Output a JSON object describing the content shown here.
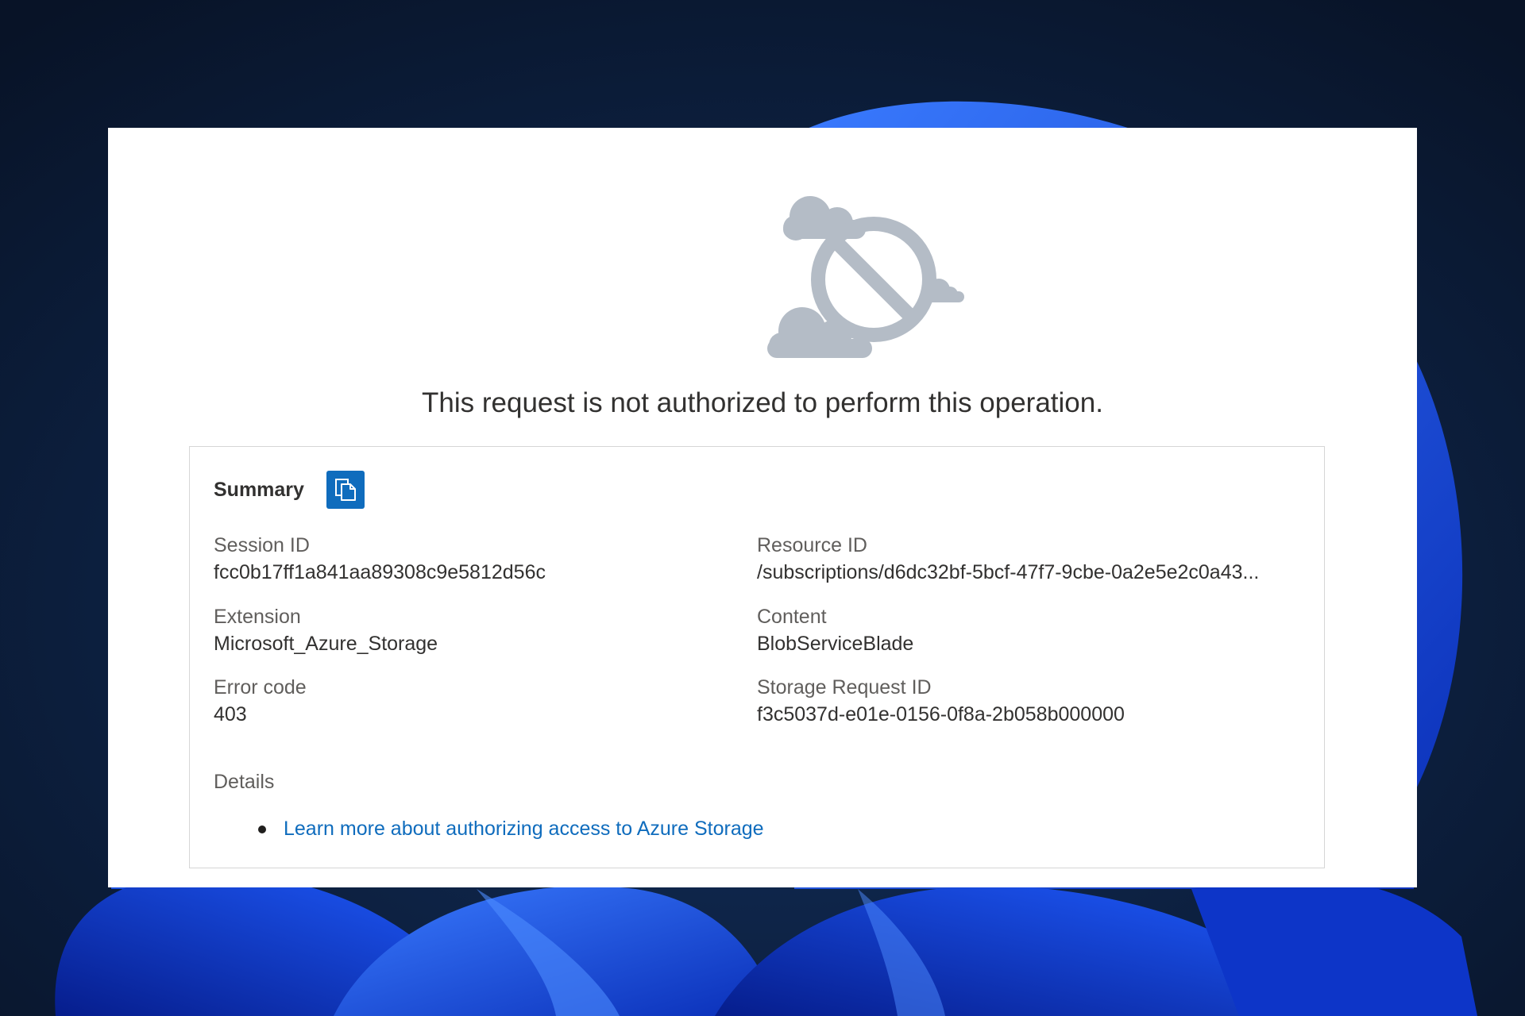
{
  "dialog": {
    "message": "This request is not authorized to perform this operation.",
    "summary": {
      "title": "Summary",
      "copy_icon": "copy-icon",
      "fields": {
        "session_id": {
          "label": "Session ID",
          "value": "fcc0b17ff1a841aa89308c9e5812d56c"
        },
        "resource_id": {
          "label": "Resource ID",
          "value": "/subscriptions/d6dc32bf-5bcf-47f7-9cbe-0a2e5e2c0a43..."
        },
        "extension": {
          "label": "Extension",
          "value": "Microsoft_Azure_Storage"
        },
        "content": {
          "label": "Content",
          "value": "BlobServiceBlade"
        },
        "error_code": {
          "label": "Error code",
          "value": "403"
        },
        "storage_request_id": {
          "label": "Storage Request ID",
          "value": "f3c5037d-e01e-0156-0f8a-2b058b000000"
        }
      },
      "details_label": "Details",
      "links": [
        {
          "text": "Learn more about authorizing access to Azure Storage"
        }
      ]
    }
  },
  "colors": {
    "link": "#0f6cbd",
    "copy_button_bg": "#0f6cbd",
    "illustration": "#b4bcc6"
  }
}
